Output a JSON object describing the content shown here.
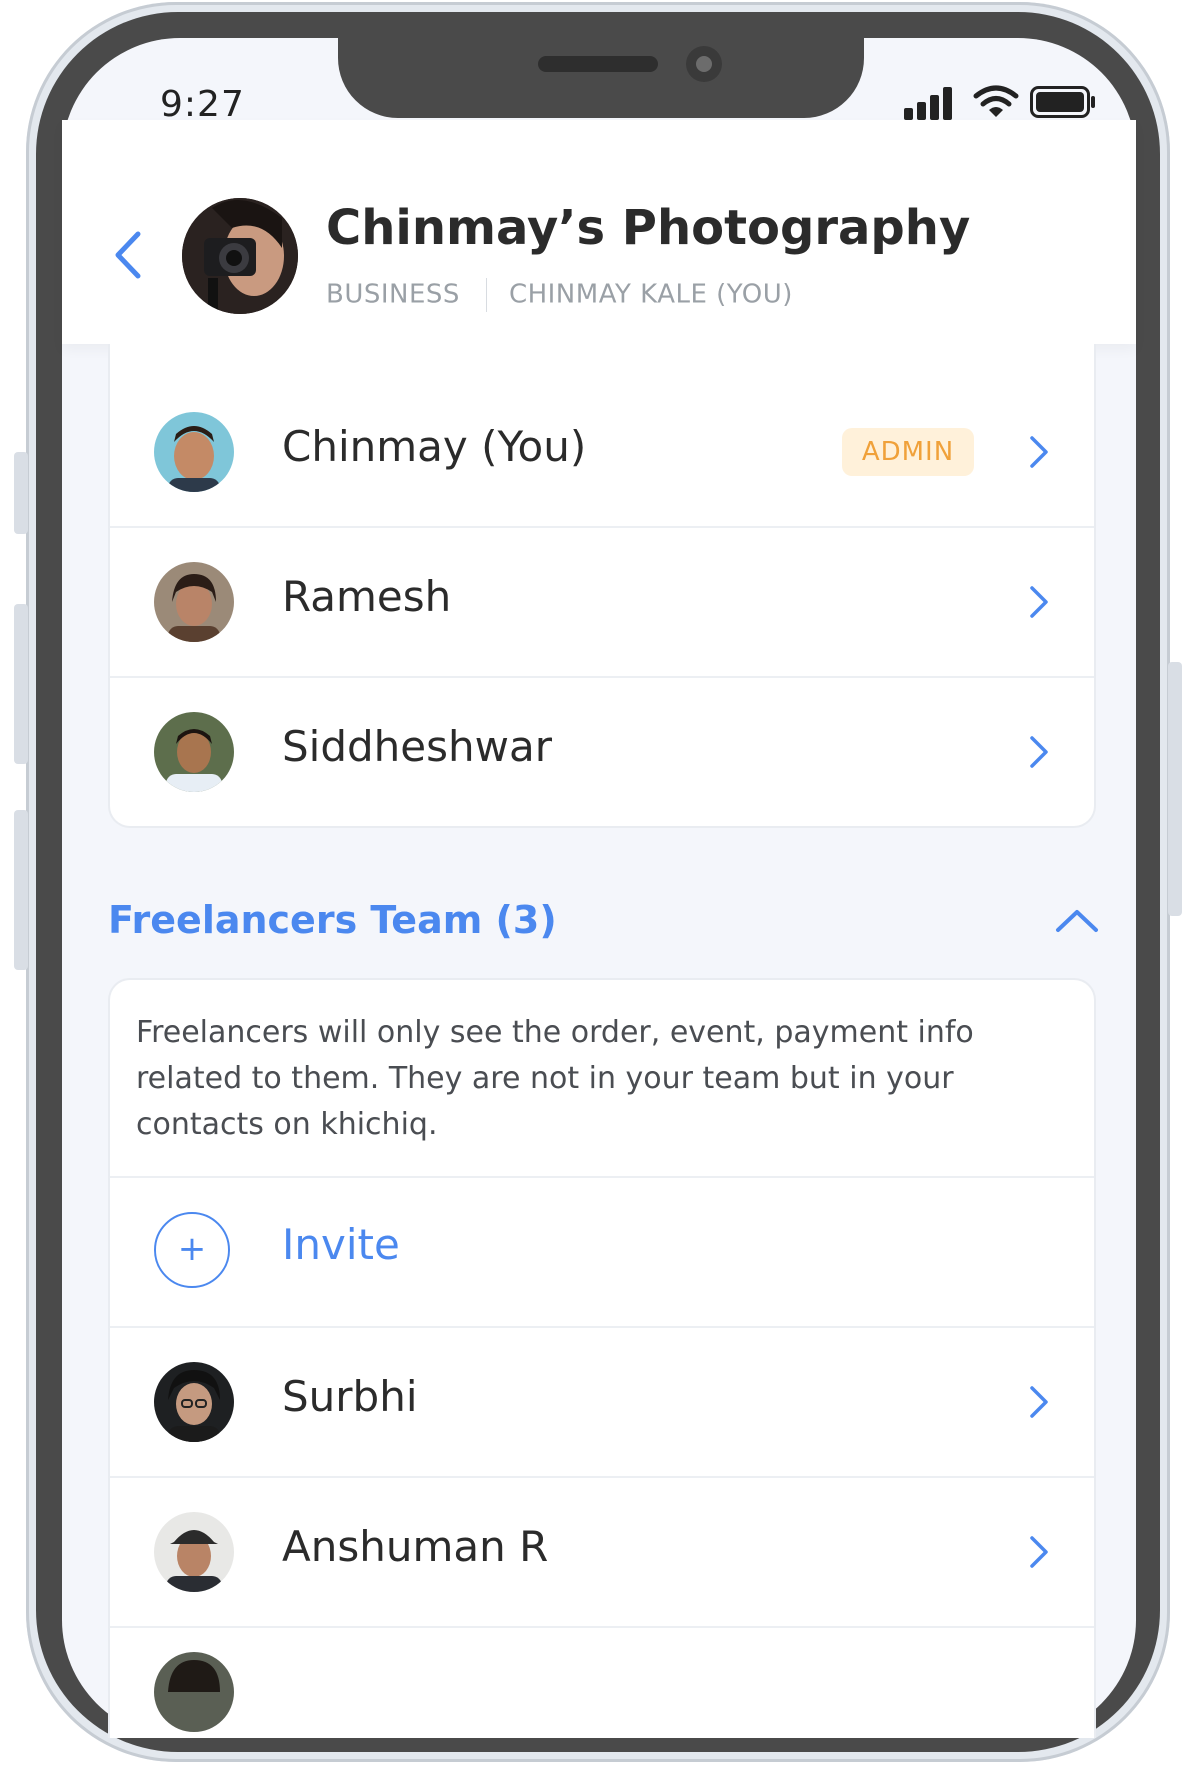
{
  "status": {
    "time": "9:27"
  },
  "header": {
    "title": "Chinmay’s Photography",
    "type_label": "BUSINESS",
    "owner_label": "CHINMAY KALE (YOU)"
  },
  "team_members": [
    {
      "name": "Chinmay (You)",
      "badge": "ADMIN"
    },
    {
      "name": "Ramesh"
    },
    {
      "name": "Siddheshwar"
    }
  ],
  "freelancers": {
    "title": "Freelancers Team (3)",
    "info": "Freelancers will only see the order, event, payment info related to them. They are not in your team but in your contacts on khichiq.",
    "invite_label": "Invite",
    "invite_icon": "+",
    "members": [
      {
        "name": "Surbhi"
      },
      {
        "name": "Anshuman R"
      }
    ]
  },
  "colors": {
    "accent": "#4b88ef",
    "badge_bg": "#fff1da",
    "badge_text": "#f0a13a",
    "background": "#f4f6fb"
  }
}
